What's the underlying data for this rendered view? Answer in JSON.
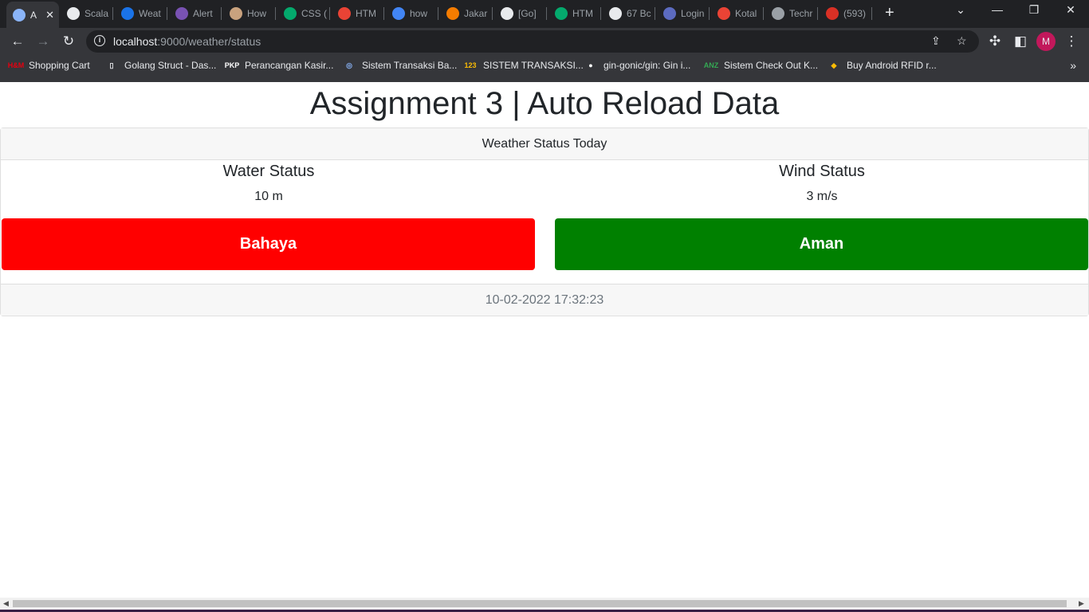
{
  "browser": {
    "tabs": [
      {
        "label": "A",
        "icon": "globe-icon",
        "color": "#8ab4f8",
        "active": true
      },
      {
        "label": "Scala",
        "icon": "scala-icon",
        "color": "#e8eaed"
      },
      {
        "label": "Weat",
        "icon": "weather-icon",
        "color": "#1a73e8"
      },
      {
        "label": "Alert",
        "icon": "bootstrap-icon",
        "color": "#7952b3"
      },
      {
        "label": "How",
        "icon": "site-icon",
        "color": "#c9a27e"
      },
      {
        "label": "CSS (",
        "icon": "w3-icon",
        "color": "#04aa6d"
      },
      {
        "label": "HTM",
        "icon": "record-icon",
        "color": "#ea4335"
      },
      {
        "label": "how",
        "icon": "google-icon",
        "color": "#4285f4"
      },
      {
        "label": "Jakar",
        "icon": "sun-icon",
        "color": "#f57c00"
      },
      {
        "label": "[Go]",
        "icon": "bulb-icon",
        "color": "#e8eaed"
      },
      {
        "label": "HTM",
        "icon": "w3-icon",
        "color": "#04aa6d"
      },
      {
        "label": "67 Bc",
        "icon": "f-icon",
        "color": "#e8eaed"
      },
      {
        "label": "Login",
        "icon": "app-icon",
        "color": "#5c6bc0"
      },
      {
        "label": "Kotal",
        "icon": "gmail-icon",
        "color": "#ea4335"
      },
      {
        "label": "Techr",
        "icon": "globe-icon",
        "color": "#9aa0a6"
      },
      {
        "label": "(593)",
        "icon": "badge-icon",
        "color": "#d93025"
      }
    ],
    "url_host": "localhost",
    "url_path": ":9000/weather/status",
    "profile_initial": "M",
    "bookmarks": [
      {
        "label": "Shopping Cart",
        "icon": "hm-icon",
        "mark": "H&M",
        "color": "#e50010"
      },
      {
        "label": "Golang Struct - Das...",
        "icon": "book-icon",
        "mark": "▯",
        "color": "#e8eaed"
      },
      {
        "label": "Perancangan Kasir...",
        "icon": "pkp-icon",
        "mark": "PKP",
        "color": "#ffffff"
      },
      {
        "label": "Sistem Transaksi Ba...",
        "icon": "seal-icon",
        "mark": "◎",
        "color": "#8ab4f8"
      },
      {
        "label": "SISTEM TRANSAKSI...",
        "icon": "dok-icon",
        "mark": "123",
        "color": "#fbbc04"
      },
      {
        "label": "gin-gonic/gin: Gin i...",
        "icon": "github-icon",
        "mark": "●",
        "color": "#ffffff"
      },
      {
        "label": "Sistem Check Out K...",
        "icon": "anz-icon",
        "mark": "ANZ",
        "color": "#34a853"
      },
      {
        "label": "Buy Android RFID r...",
        "icon": "shop-icon",
        "mark": "◆",
        "color": "#fbbc04"
      }
    ]
  },
  "page": {
    "title": "Assignment 3 | Auto Reload Data",
    "header": "Weather Status Today",
    "water": {
      "title": "Water Status",
      "value": "10 m",
      "status": "Bahaya",
      "color": "#ff0000"
    },
    "wind": {
      "title": "Wind Status",
      "value": "3 m/s",
      "status": "Aman",
      "color": "#008000"
    },
    "timestamp": "10-02-2022 17:32:23"
  }
}
